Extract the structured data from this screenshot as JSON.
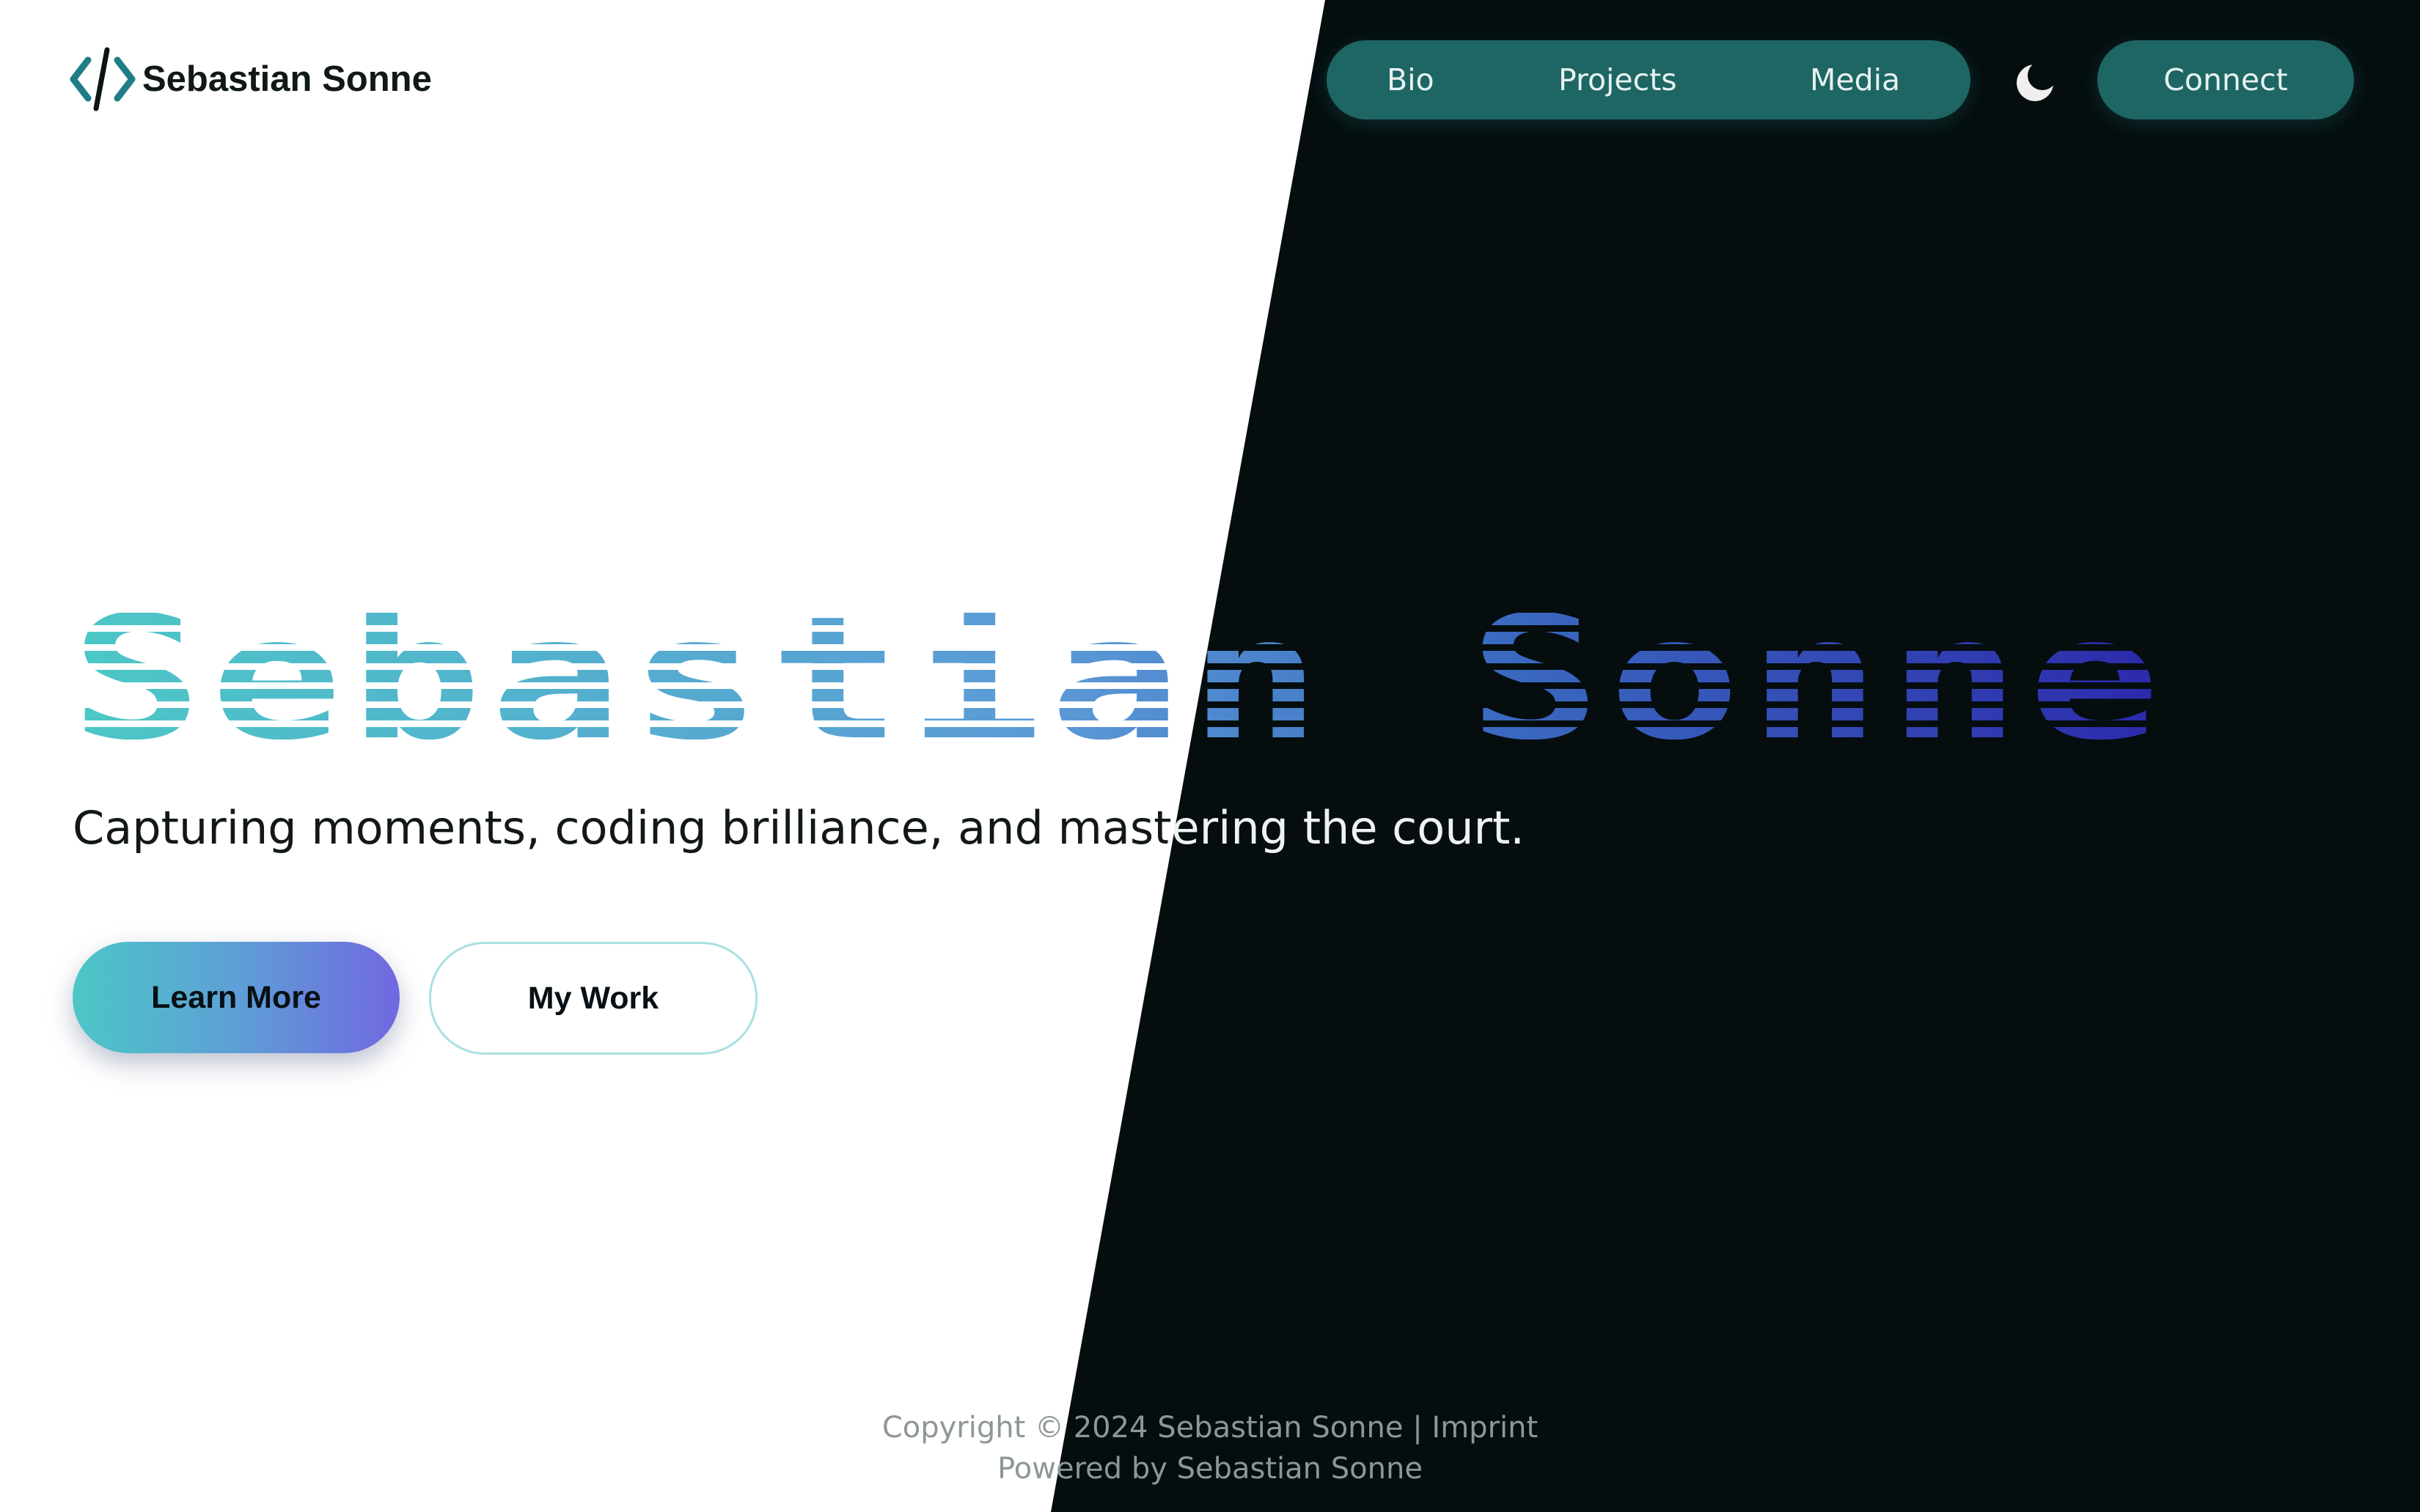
{
  "brand": {
    "logo_icon": "code-brackets-icon",
    "name": "Sebastian Sonne"
  },
  "nav": {
    "items": [
      {
        "label": "Bio"
      },
      {
        "label": "Projects"
      },
      {
        "label": "Media"
      }
    ],
    "theme_toggle_icon": "moon-icon",
    "connect_label": "Connect"
  },
  "hero": {
    "title": "Sebastian Sonne",
    "tagline": "Capturing moments, coding brilliance, and mastering the court.",
    "primary_button": "Learn More",
    "secondary_button": "My Work"
  },
  "footer": {
    "copyright": "Copyright © 2024 Sebastian Sonne",
    "separator": "|",
    "imprint": "Imprint",
    "powered_by": "Powered by Sebastian Sonne"
  },
  "colors": {
    "nav_bg": "#1e6664",
    "dark_bg": "#050d0f",
    "gradient_start": "#4cc7c6",
    "gradient_end": "#2a22a8",
    "button_gradient_end": "#7168e0"
  }
}
